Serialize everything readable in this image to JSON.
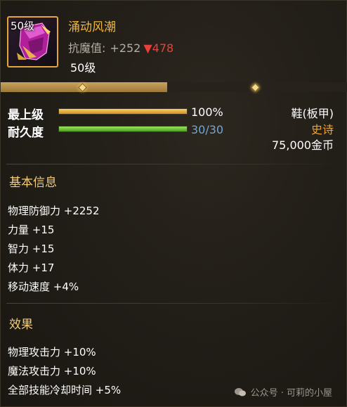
{
  "item": {
    "level_badge": "50级",
    "name": "涌动风潮",
    "resist_label": "抗魔值:",
    "resist_plus": "+252",
    "resist_down_icon": "down-triangle-icon",
    "resist_down": "478",
    "required_level": "50级",
    "slot": "鞋(板甲)",
    "rarity": "史诗",
    "price": "75,000金币"
  },
  "exp_progress": 0.48,
  "stats": {
    "max_level_label": "最上级",
    "max_level_percent": 100,
    "max_level_value": "100%",
    "durability_label": "耐久度",
    "durability_current": 30,
    "durability_max": 30,
    "durability_value": "30/30"
  },
  "basic_info": {
    "title": "基本信息",
    "attributes": [
      "物理防御力 +2252",
      "力量 +15",
      "智力 +15",
      "体力 +17",
      "移动速度 +4%"
    ]
  },
  "effects": {
    "title": "效果",
    "attributes": [
      "物理攻击力 +10%",
      "魔法攻击力 +10%",
      "全部技能冷却时间 +5%"
    ]
  },
  "watermark": {
    "icon": "wechat-icon",
    "text": "公众号 · 可莉的小屋"
  },
  "colors": {
    "item_name": "#f2b53d",
    "rarity_epic": "#f0a331",
    "resist_down": "#e8403b",
    "durability_text": "#6fa7d6",
    "section_title": "#f2cc7a"
  }
}
